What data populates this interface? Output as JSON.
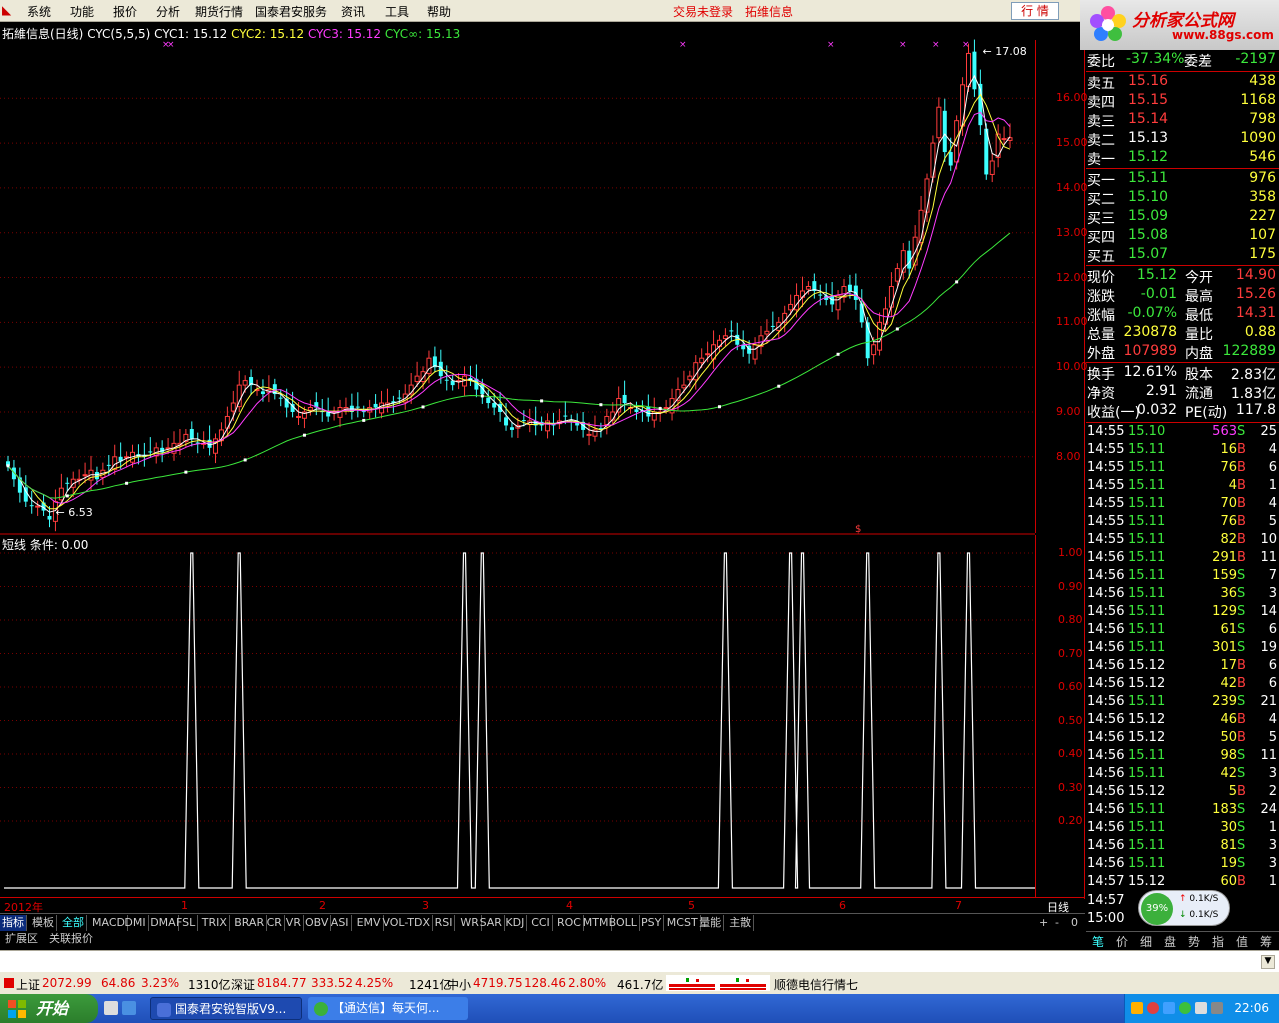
{
  "menu": {
    "items": [
      "系统",
      "功能",
      "报价",
      "分析",
      "期货行情",
      "国泰君安服务",
      "资讯",
      "工具",
      "帮助"
    ],
    "login_status": "交易未登录",
    "stock_name": "拓维信息",
    "quote_button": "行 情"
  },
  "logo": {
    "text": "分析家公式网",
    "url": "www.88gs.com"
  },
  "chart": {
    "title_name": "拓維信息(日线)",
    "indicator": "CYC(5,5,5)",
    "cyc1": "CYC1: 15.12",
    "cyc2": "CYC2: 15.12",
    "cyc3": "CYC3: 15.12",
    "cycinf": "CYC∞: 15.13",
    "high_label": "17.08",
    "low_label": "6.53",
    "price_ticks": [
      "16.00",
      "15.00",
      "14.00",
      "13.00",
      "12.00",
      "11.00",
      "10.00",
      "9.00",
      "8.00"
    ],
    "ind_title": "短线  条件: 0.00",
    "ind_ticks": [
      "1.00",
      "0.90",
      "0.80",
      "0.70",
      "0.60",
      "0.50",
      "0.40",
      "0.30",
      "0.20"
    ],
    "year_label": "2012年",
    "months": [
      "1",
      "2",
      "3",
      "4",
      "5",
      "6",
      "7"
    ],
    "period_label": "日线"
  },
  "chart_data": {
    "type": "candlestick",
    "ylim": [
      6.3,
      17.3
    ],
    "closes": [
      7.8,
      7.5,
      7.2,
      7.0,
      6.9,
      6.9,
      6.8,
      6.6,
      7.0,
      7.3,
      7.4,
      7.5,
      7.5,
      7.6,
      7.7,
      7.5,
      7.7,
      7.8,
      8.0,
      7.9,
      8.0,
      8.1,
      8.0,
      8.0,
      8.1,
      8.2,
      8.1,
      8.2,
      8.3,
      8.3,
      8.5,
      8.4,
      8.3,
      8.3,
      8.2,
      8.4,
      8.6,
      8.9,
      9.2,
      9.6,
      9.7,
      9.6,
      9.5,
      9.4,
      9.5,
      9.4,
      9.3,
      9.1,
      9.0,
      8.9,
      9.0,
      9.1,
      9.1,
      9.0,
      8.9,
      9.0,
      9.1,
      9.1,
      9.0,
      9.1,
      9.0,
      9.1,
      9.1,
      9.2,
      9.2,
      9.2,
      9.3,
      9.4,
      9.6,
      9.8,
      9.9,
      10.2,
      10.0,
      9.8,
      9.7,
      9.6,
      9.7,
      9.8,
      9.7,
      9.5,
      9.4,
      9.2,
      9.1,
      9.0,
      8.7,
      8.6,
      8.7,
      8.8,
      8.8,
      8.7,
      8.7,
      8.8,
      8.7,
      8.8,
      8.9,
      8.8,
      8.7,
      8.6,
      8.5,
      8.6,
      8.6,
      8.9,
      9.0,
      9.3,
      9.2,
      9.1,
      9.0,
      9.0,
      8.9,
      9.0,
      9.0,
      9.1,
      9.3,
      9.5,
      9.6,
      9.8,
      10.1,
      10.2,
      10.3,
      10.5,
      10.6,
      10.7,
      10.8,
      10.5,
      10.4,
      10.3,
      10.5,
      10.7,
      10.8,
      10.9,
      11.0,
      11.2,
      11.4,
      11.6,
      11.7,
      11.8,
      11.7,
      11.6,
      11.5,
      11.4,
      11.6,
      11.8,
      11.7,
      11.5,
      11.0,
      10.2,
      10.5,
      11.0,
      11.3,
      11.8,
      12.2,
      12.6,
      12.2,
      12.9,
      13.5,
      14.2,
      15.0,
      15.8,
      14.8,
      14.5,
      15.5,
      16.3,
      17.0,
      16.2,
      15.4,
      14.3,
      14.6,
      15.2,
      15.1,
      15.12
    ],
    "signal_positions": [
      31,
      39,
      77,
      80,
      121,
      132,
      134,
      145,
      157,
      162,
      182
    ]
  },
  "quote": {
    "weibi": {
      "label": "委比",
      "value": "-37.34%",
      "label2": "委差",
      "value2": "-2197"
    },
    "sells": [
      {
        "label": "卖五",
        "price": "15.16",
        "vol": "438"
      },
      {
        "label": "卖四",
        "price": "15.15",
        "vol": "1168"
      },
      {
        "label": "卖三",
        "price": "15.14",
        "vol": "798"
      },
      {
        "label": "卖二",
        "price": "15.13",
        "vol": "1090"
      },
      {
        "label": "卖一",
        "price": "15.12",
        "vol": "546"
      }
    ],
    "buys": [
      {
        "label": "买一",
        "price": "15.11",
        "vol": "976"
      },
      {
        "label": "买二",
        "price": "15.10",
        "vol": "358"
      },
      {
        "label": "买三",
        "price": "15.09",
        "vol": "227"
      },
      {
        "label": "买四",
        "price": "15.08",
        "vol": "107"
      },
      {
        "label": "买五",
        "price": "15.07",
        "vol": "175"
      }
    ],
    "stats": [
      {
        "l1": "现价",
        "v1": "15.12",
        "l2": "今开",
        "v2": "14.90",
        "c1": "green",
        "c2": "red"
      },
      {
        "l1": "涨跌",
        "v1": "-0.01",
        "l2": "最高",
        "v2": "15.26",
        "c1": "green",
        "c2": "red"
      },
      {
        "l1": "涨幅",
        "v1": "-0.07%",
        "l2": "最低",
        "v2": "14.31",
        "c1": "green",
        "c2": "red"
      },
      {
        "l1": "总量",
        "v1": "230878",
        "l2": "量比",
        "v2": "0.88",
        "c1": "yellow",
        "c2": "yellow"
      },
      {
        "l1": "外盘",
        "v1": "107989",
        "l2": "内盘",
        "v2": "122889",
        "c1": "red",
        "c2": "green"
      }
    ],
    "stats2": [
      {
        "l1": "换手",
        "v1": "12.61%",
        "l2": "股本",
        "v2": "2.83亿"
      },
      {
        "l1": "净资",
        "v1": "2.91",
        "l2": "流通",
        "v2": "1.83亿"
      },
      {
        "l1": "收益(一)",
        "v1": "0.032",
        "l2": "PE(动)",
        "v2": "117.8"
      }
    ]
  },
  "ticks": [
    {
      "t": "14:55",
      "p": "15.10",
      "v": "563",
      "bs": "S",
      "n": "25"
    },
    {
      "t": "14:55",
      "p": "15.11",
      "v": "16",
      "bs": "B",
      "n": "4"
    },
    {
      "t": "14:55",
      "p": "15.11",
      "v": "76",
      "bs": "B",
      "n": "6"
    },
    {
      "t": "14:55",
      "p": "15.11",
      "v": "4",
      "bs": "B",
      "n": "1"
    },
    {
      "t": "14:55",
      "p": "15.11",
      "v": "70",
      "bs": "B",
      "n": "4"
    },
    {
      "t": "14:55",
      "p": "15.11",
      "v": "76",
      "bs": "B",
      "n": "5"
    },
    {
      "t": "14:55",
      "p": "15.11",
      "v": "82",
      "bs": "B",
      "n": "10"
    },
    {
      "t": "14:56",
      "p": "15.11",
      "v": "291",
      "bs": "B",
      "n": "11"
    },
    {
      "t": "14:56",
      "p": "15.11",
      "v": "159",
      "bs": "S",
      "n": "7"
    },
    {
      "t": "14:56",
      "p": "15.11",
      "v": "36",
      "bs": "S",
      "n": "3"
    },
    {
      "t": "14:56",
      "p": "15.11",
      "v": "129",
      "bs": "S",
      "n": "14"
    },
    {
      "t": "14:56",
      "p": "15.11",
      "v": "61",
      "bs": "S",
      "n": "6"
    },
    {
      "t": "14:56",
      "p": "15.11",
      "v": "301",
      "bs": "S",
      "n": "19"
    },
    {
      "t": "14:56",
      "p": "15.12",
      "v": "17",
      "bs": "B",
      "n": "6"
    },
    {
      "t": "14:56",
      "p": "15.12",
      "v": "42",
      "bs": "B",
      "n": "6"
    },
    {
      "t": "14:56",
      "p": "15.11",
      "v": "239",
      "bs": "S",
      "n": "21"
    },
    {
      "t": "14:56",
      "p": "15.12",
      "v": "46",
      "bs": "B",
      "n": "4"
    },
    {
      "t": "14:56",
      "p": "15.12",
      "v": "50",
      "bs": "B",
      "n": "5"
    },
    {
      "t": "14:56",
      "p": "15.11",
      "v": "98",
      "bs": "S",
      "n": "11"
    },
    {
      "t": "14:56",
      "p": "15.11",
      "v": "42",
      "bs": "S",
      "n": "3"
    },
    {
      "t": "14:56",
      "p": "15.12",
      "v": "5",
      "bs": "B",
      "n": "2"
    },
    {
      "t": "14:56",
      "p": "15.11",
      "v": "183",
      "bs": "S",
      "n": "24"
    },
    {
      "t": "14:56",
      "p": "15.11",
      "v": "30",
      "bs": "S",
      "n": "1"
    },
    {
      "t": "14:56",
      "p": "15.11",
      "v": "81",
      "bs": "S",
      "n": "3"
    },
    {
      "t": "14:56",
      "p": "15.11",
      "v": "19",
      "bs": "S",
      "n": "3"
    },
    {
      "t": "14:57",
      "p": "15.12",
      "v": "60",
      "bs": "B",
      "n": "1"
    }
  ],
  "tick_extra": {
    "t1": "14:57",
    "t2": "15:00",
    "gauge_pct": "39%",
    "up_speed": "0.1K/S",
    "down_speed": "0.1K/S"
  },
  "tabs": [
    "指标",
    "模板",
    "全部",
    "MACD",
    "DMI",
    "DMA",
    "FSL",
    "TRIX",
    "BRAR",
    "CR",
    "VR",
    "OBV",
    "ASI",
    "EMV",
    "VOL-TDX",
    "RSI",
    "WR",
    "SAR",
    "KDJ",
    "CCI",
    "ROC",
    "MTM",
    "BOLL",
    "PSY",
    "MCST",
    "量能",
    "主散"
  ],
  "tabs2": [
    "扩展区",
    "关联报价"
  ],
  "tab_controls": [
    "+",
    "-",
    "0"
  ],
  "rp_tabs": [
    "笔",
    "价",
    "细",
    "盘",
    "势",
    "指",
    "值",
    "筹"
  ],
  "status": {
    "sh_label": "上证",
    "sh_val": "2072.99",
    "sh_chg": "64.86",
    "sh_pct": "3.23%",
    "sh_amt": "1310亿",
    "sz_label": "深证",
    "sz_val": "8184.77",
    "sz_chg": "333.52",
    "sz_pct": "4.25%",
    "sz_amt": "1241亿",
    "zx_label": "中小",
    "zx_val": "4719.75",
    "zx_chg": "128.46",
    "zx_pct": "2.80%",
    "zx_amt": "461.7亿",
    "news": "顺德电信行情七"
  },
  "taskbar": {
    "start": "开始",
    "task1": "国泰君安锐智版V9...",
    "task2": "【通达信】每天何...",
    "clock": "22:06"
  }
}
